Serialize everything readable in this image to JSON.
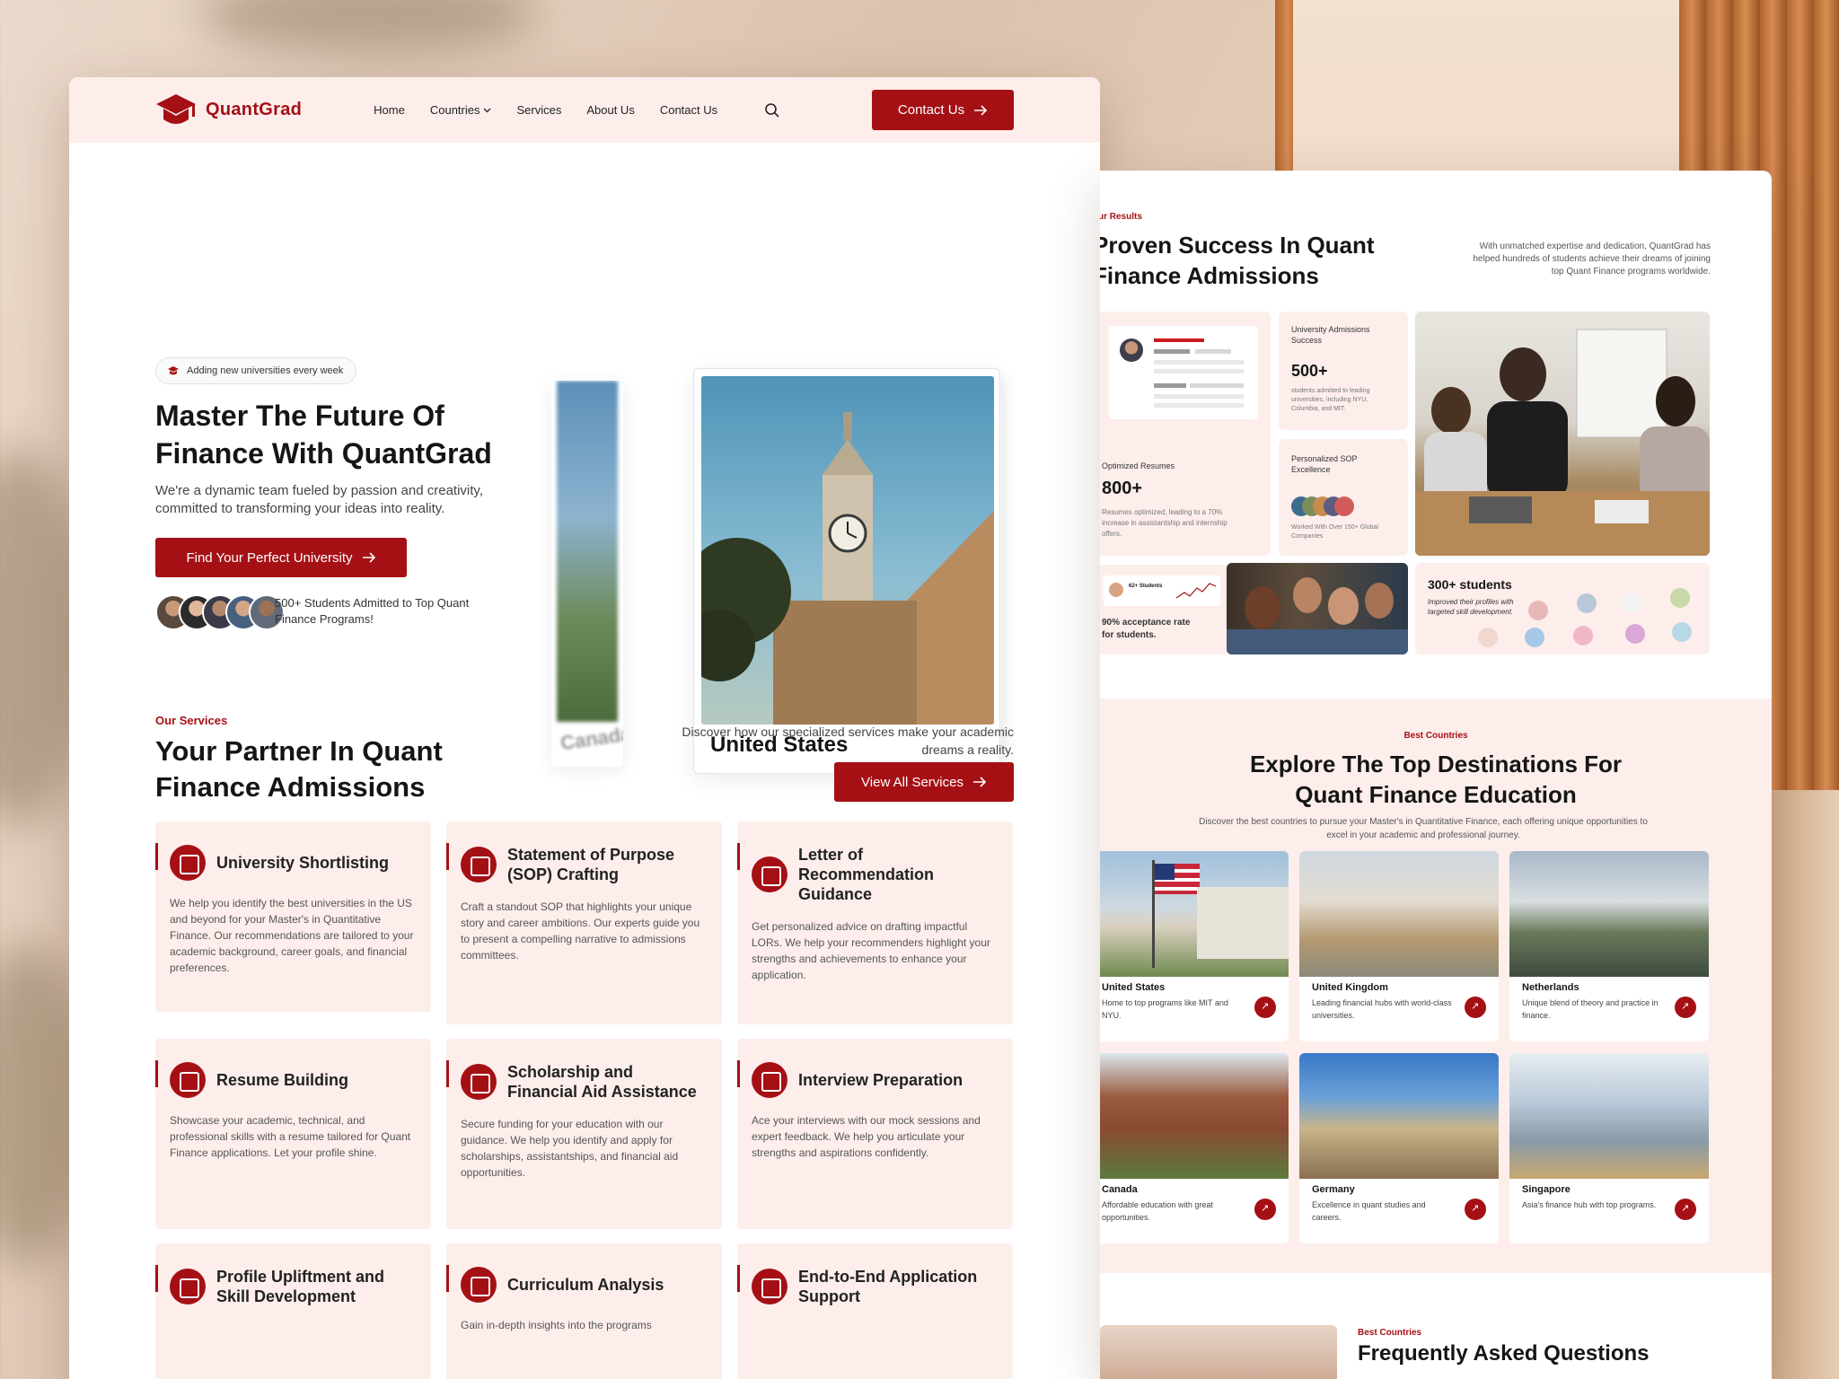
{
  "nav": {
    "brand": "QuantGrad",
    "links": [
      "Home",
      "Countries",
      "Services",
      "About Us",
      "Contact Us"
    ],
    "cta": "Contact Us"
  },
  "hero": {
    "badge": "Adding new universities every week",
    "title": "Master The Future Of Finance With QuantGrad",
    "subtitle": "We're a dynamic team fueled by passion and creativity, committed to transforming your ideas into reality.",
    "button": "Find Your Perfect University",
    "proof": "500+ Students Admitted to Top Quant Finance Programs!",
    "featured_country": "United States",
    "side_country": "Canada"
  },
  "services": {
    "eyebrow": "Our Services",
    "title": "Your Partner In Quant Finance Admissions",
    "description": "Discover how our specialized services make your academic dreams a reality.",
    "button": "View All Services",
    "items": [
      {
        "name": "University Shortlisting",
        "text": "We help you identify the best universities in the US and beyond for your Master's in Quantitative Finance. Our recommendations are tailored to your academic background, career goals, and financial preferences."
      },
      {
        "name": "Statement of Purpose (SOP) Crafting",
        "text": "Craft a standout SOP that highlights your unique story and career ambitions. Our experts guide you to present a compelling narrative to admissions committees."
      },
      {
        "name": "Letter of Recommendation Guidance",
        "text": "Get personalized advice on drafting impactful LORs. We help your recommenders highlight your strengths and achievements to enhance your application."
      },
      {
        "name": "Resume Building",
        "text": "Showcase your academic, technical, and professional skills with a resume tailored for Quant Finance applications. Let your profile shine."
      },
      {
        "name": "Scholarship and Financial Aid Assistance",
        "text": "Secure funding for your education with our guidance. We help you identify and apply for scholarships, assistantships, and financial aid opportunities."
      },
      {
        "name": "Interview Preparation",
        "text": "Ace your interviews with our mock sessions and expert feedback. We help you articulate your strengths and aspirations confidently."
      },
      {
        "name": "Profile Upliftment and Skill Development",
        "text": ""
      },
      {
        "name": "Curriculum Analysis",
        "text": "Gain in-depth insights into the programs"
      },
      {
        "name": "End-to-End Application Support",
        "text": ""
      }
    ]
  },
  "results": {
    "eyebrow": "ur Results",
    "title_line1": "Proven Success In Quant",
    "title_line2": "Finance Admissions",
    "description": "With unmatched expertise and dedication, QuantGrad has helped hundreds of students achieve their dreams of joining top Quant Finance programs worldwide.",
    "resumes": {
      "label": "Optimized Resumes",
      "value": "800+",
      "note": "Resumes optimized, leading to a 70% increase in assistantship and internship offers."
    },
    "admissions": {
      "label": "University Admissions Success",
      "value": "500+",
      "note": "students admitted to leading universities, including NYU, Columbia, and MIT."
    },
    "sop": {
      "label": "Personalized SOP Excellence",
      "note": "Worked With Over 150+ Global Companies"
    },
    "acceptance": {
      "mini": "62+ Students",
      "text": "90% acceptance rate for students."
    },
    "students": {
      "value": "300+ students",
      "note": "Improved their profiles with targeted skill development."
    }
  },
  "destinations": {
    "eyebrow": "Best Countries",
    "title_line1": "Explore The Top Destinations For",
    "title_line2": "Quant Finance Education",
    "subtitle": "Discover the best countries to pursue your Master's in Quantitative Finance, each offering unique opportunities to excel in your academic and professional journey.",
    "countries": [
      {
        "name": "United States",
        "desc": "Home to top programs like MIT and NYU."
      },
      {
        "name": "United Kingdom",
        "desc": "Leading financial hubs with world-class universities."
      },
      {
        "name": "Netherlands",
        "desc": "Unique blend of theory and practice in finance."
      },
      {
        "name": "Canada",
        "desc": "Affordable education with great opportunities."
      },
      {
        "name": "Germany",
        "desc": "Excellence in quant studies and careers."
      },
      {
        "name": "Singapore",
        "desc": "Asia's finance hub with top programs."
      }
    ]
  },
  "faq": {
    "eyebrow": "Best Countries",
    "title": "Frequently Asked Questions"
  },
  "colors": {
    "brand": "#a51015",
    "blush": "#fdeeec"
  }
}
